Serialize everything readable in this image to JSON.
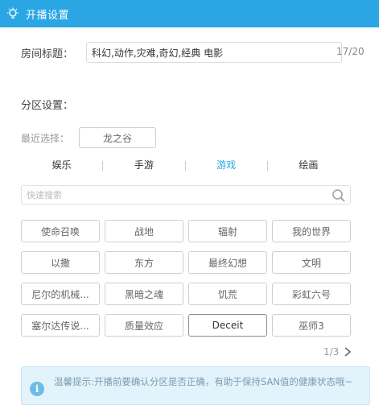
{
  "window": {
    "title": "开播设置"
  },
  "room": {
    "title_label": "房间标题：",
    "title_value": "科幻,动作,灾难,奇幻,经典 电影",
    "counter": "17/20"
  },
  "section": {
    "label": "分区设置："
  },
  "recent": {
    "label": "最近选择：",
    "chip": "龙之谷"
  },
  "tabs": [
    {
      "label": "娱乐",
      "active": false
    },
    {
      "label": "手游",
      "active": false
    },
    {
      "label": "游戏",
      "active": true
    },
    {
      "label": "绘画",
      "active": false
    }
  ],
  "search": {
    "placeholder": "快速搜索"
  },
  "categories": [
    "使命召唤",
    "战地",
    "辐射",
    "我的世界",
    "以撒",
    "东方",
    "最终幻想",
    "文明",
    "尼尔的机械...",
    "黑暗之魂",
    "饥荒",
    "彩虹六号",
    "塞尔达传说...",
    "质量效应",
    "Deceit",
    "巫师3"
  ],
  "selected_category": "Deceit",
  "pager": {
    "text": "1/3"
  },
  "tip": {
    "icon": "info-icon",
    "text": "温馨提示:开播前要确认分区是否正确，有助于保持SAN值的健康状态哦~"
  },
  "colors": {
    "accent": "#2aa6e4",
    "tip_bg": "#e3f3fb"
  }
}
